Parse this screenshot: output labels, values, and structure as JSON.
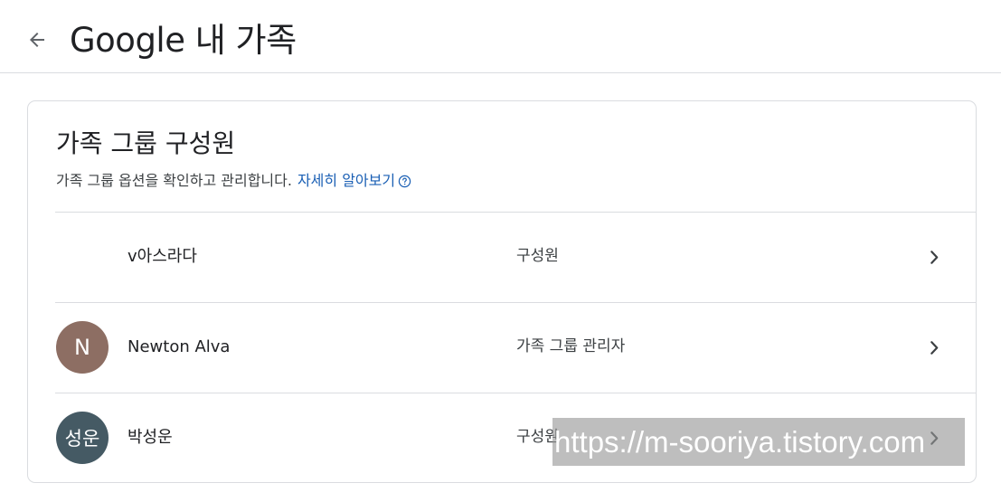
{
  "header": {
    "back_icon": "arrow-left-icon",
    "title": "Google 내 가족"
  },
  "card": {
    "title": "가족 그룹 구성원",
    "description": "가족 그룹 옵션을 확인하고 관리합니다.",
    "learn_more": "자세히 알아보기",
    "help_icon": "question-circle-icon"
  },
  "members": [
    {
      "name": "v아스라다",
      "role": "구성원",
      "avatar_text": "",
      "avatar_color": ""
    },
    {
      "name": "Newton Alva",
      "role": "가족 그룹 관리자",
      "avatar_text": "N",
      "avatar_color": "#8d6e63"
    },
    {
      "name": "박성운",
      "role": "구성원",
      "avatar_text": "성운",
      "avatar_color": "#455a64"
    }
  ],
  "watermark": "https://m-sooriya.tistory.com",
  "colors": {
    "link": "#1a5fb4",
    "divider": "#dadce0",
    "text": "#202124"
  }
}
